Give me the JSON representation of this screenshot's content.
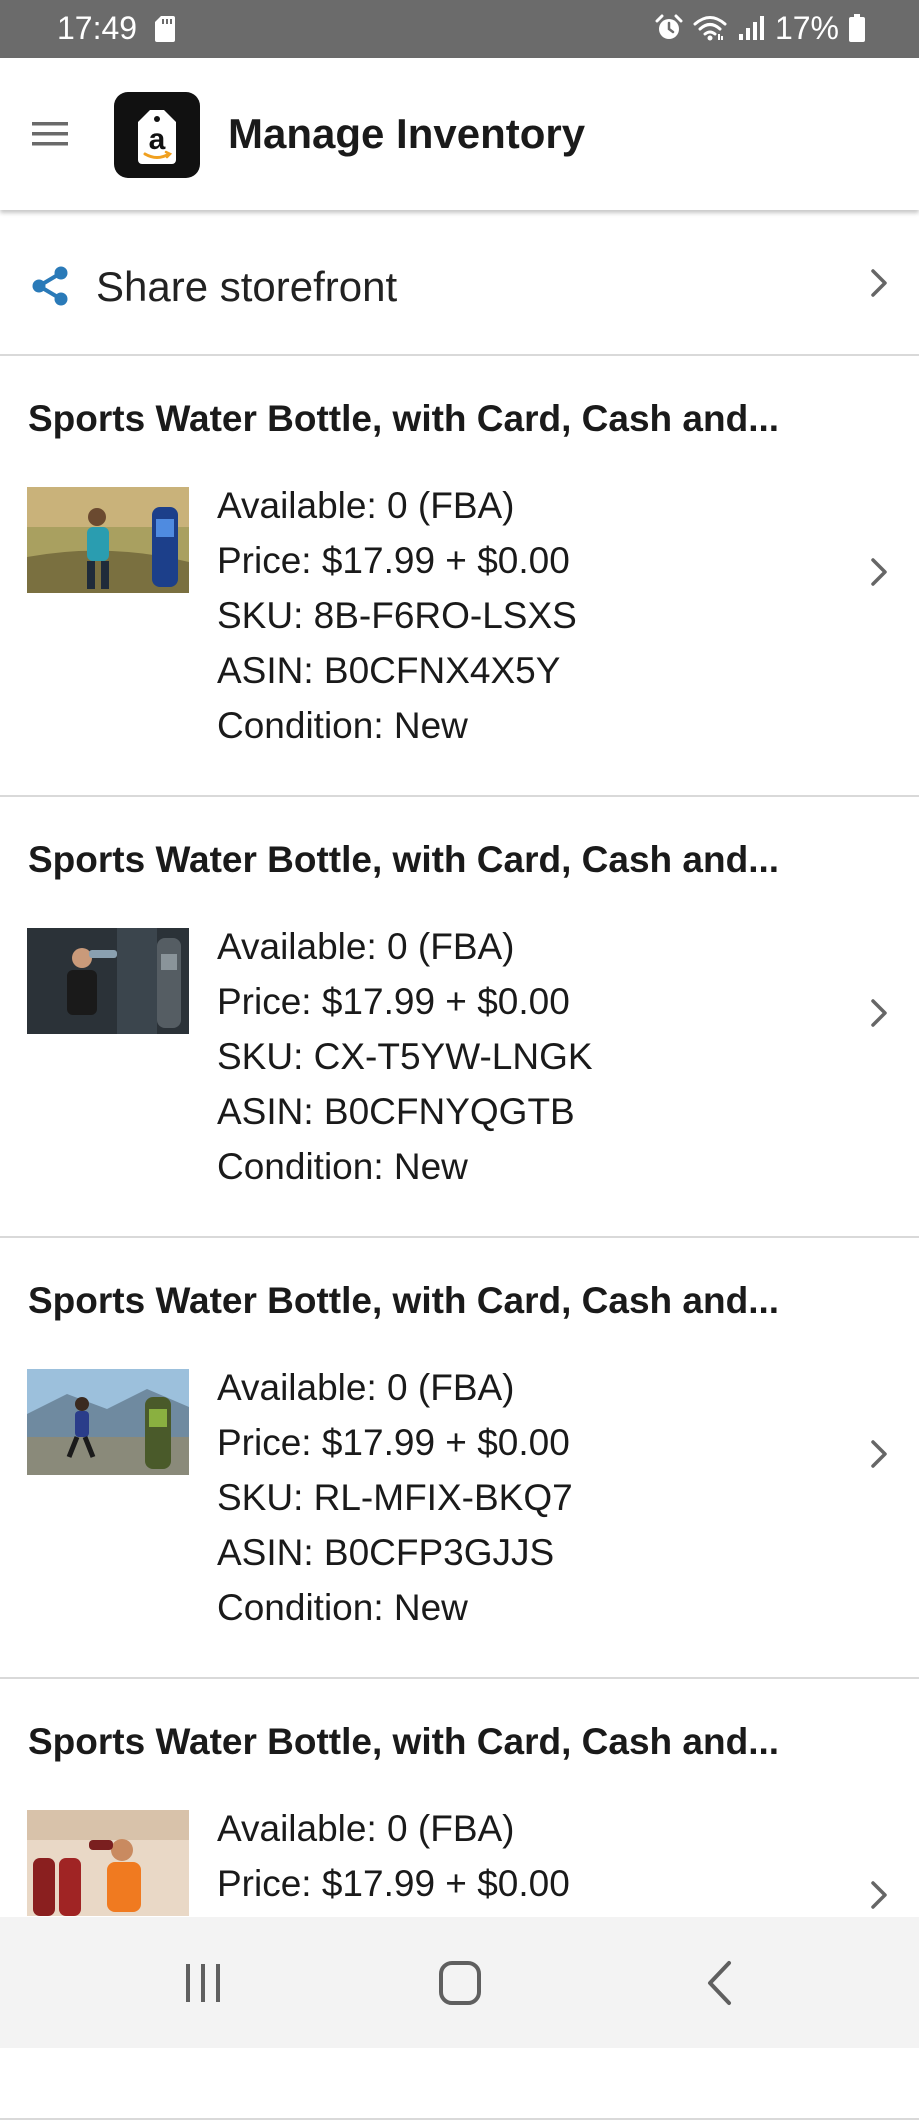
{
  "status_bar": {
    "time": "17:49",
    "battery": "17%",
    "icons": [
      "sd-card-icon",
      "alarm-icon",
      "wifi-icon",
      "signal-icon",
      "battery-icon"
    ]
  },
  "app_bar": {
    "title": "Manage Inventory",
    "logo_letter": "a",
    "logo_icon": "amazon-tag-logo",
    "menu_icon": "hamburger-menu-icon"
  },
  "share": {
    "label": "Share storefront",
    "icon": "share-icon"
  },
  "colors": {
    "status_bar_bg": "#6b6b6b",
    "accent_blue": "#2a7ab8",
    "divider": "#d9d9d9",
    "nav_bar_bg": "#f3f3f3",
    "amazon_orange": "#f0a020"
  },
  "listings": [
    {
      "title": "Sports Water Bottle, with Card, Cash and...",
      "available": "Available: 0 (FBA)",
      "price": "Price: $17.99 + $0.00",
      "sku": "SKU: 8B-F6RO-LSXS",
      "asin": "ASIN: B0CFNX4X5Y",
      "condition": "Condition: New"
    },
    {
      "title": "Sports Water Bottle, with Card, Cash and...",
      "available": "Available: 0 (FBA)",
      "price": "Price: $17.99 + $0.00",
      "sku": "SKU: CX-T5YW-LNGK",
      "asin": "ASIN: B0CFNYQGTB",
      "condition": "Condition: New"
    },
    {
      "title": "Sports Water Bottle, with Card, Cash and...",
      "available": "Available: 0 (FBA)",
      "price": "Price: $17.99 + $0.00",
      "sku": "SKU: RL-MFIX-BKQ7",
      "asin": "ASIN: B0CFP3GJJS",
      "condition": "Condition: New"
    },
    {
      "title": "Sports Water Bottle, with Card, Cash and...",
      "available": "Available: 0 (FBA)",
      "price": "Price: $17.99 + $0.00"
    }
  ],
  "nav_bar": {
    "icons": [
      "recent-apps-icon",
      "home-icon",
      "back-icon"
    ]
  }
}
